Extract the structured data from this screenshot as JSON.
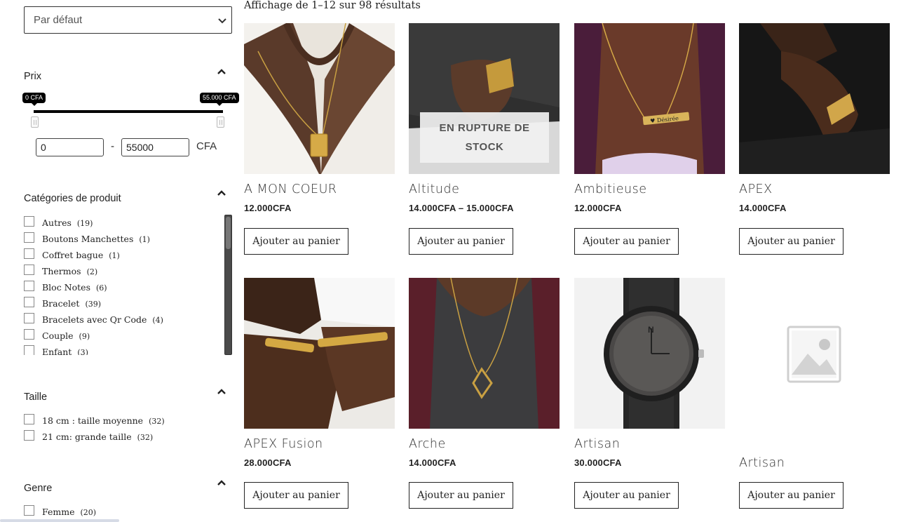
{
  "sidebar": {
    "sort": {
      "selected": "Par défaut"
    },
    "price": {
      "title": "Prix",
      "min_badge": "0 CFA",
      "max_badge": "55.000 CFA",
      "min_value": "0",
      "max_value": "55000",
      "unit": "CFA",
      "range_selected": [
        0,
        55000
      ]
    },
    "categories": {
      "title": "Catégories de produit",
      "items": [
        {
          "label": "Autres",
          "count": "(19)"
        },
        {
          "label": "Boutons Manchettes",
          "count": "(1)"
        },
        {
          "label": "Coffret bague",
          "count": "(1)"
        },
        {
          "label": "Thermos",
          "count": "(2)"
        },
        {
          "label": "Bloc Notes",
          "count": "(6)"
        },
        {
          "label": "Bracelet",
          "count": "(39)"
        },
        {
          "label": "Bracelets avec Qr Code",
          "count": "(4)"
        },
        {
          "label": "Couple",
          "count": "(9)"
        },
        {
          "label": "Enfant",
          "count": "(3)"
        }
      ]
    },
    "size": {
      "title": "Taille",
      "items": [
        {
          "label": "18 cm : taille moyenne",
          "count": "(32)"
        },
        {
          "label": "21 cm: grande taille",
          "count": "(32)"
        }
      ]
    },
    "gender": {
      "title": "Genre",
      "items": [
        {
          "label": "Femme",
          "count": "(20)"
        }
      ]
    }
  },
  "main": {
    "results_text": "Affichage de 1–12 sur 98 résultats",
    "add_to_cart_label": "Ajouter au panier",
    "out_of_stock_label": "EN RUPTURE DE STOCK",
    "products": [
      {
        "name": "A MON COEUR",
        "price": "12.000CFA",
        "image": "gold-pendant-necklace"
      },
      {
        "name": "Altitude",
        "price": "14.000CFA  –  15.000CFA",
        "image": "gold-id-bracelet",
        "out_of_stock": true
      },
      {
        "name": "Ambitieuse",
        "price": "12.000CFA",
        "image": "name-bar-necklace",
        "engraving": "Désirée"
      },
      {
        "name": "APEX",
        "price": "14.000CFA",
        "image": "gold-link-bracelet"
      },
      {
        "name": "APEX Fusion",
        "price": "28.000CFA",
        "image": "two-gold-bracelets"
      },
      {
        "name": "Arche",
        "price": "14.000CFA",
        "image": "gold-geometric-pendant"
      },
      {
        "name": "Artisan",
        "price": "30.000CFA",
        "image": "wooden-watch",
        "watch_logo": "N"
      },
      {
        "name": "Artisan",
        "price": "",
        "image": "placeholder-image"
      }
    ]
  },
  "colors": {
    "text": "#222222",
    "badge": "#000000",
    "out_of_stock_bg": "#f0f0f0"
  }
}
